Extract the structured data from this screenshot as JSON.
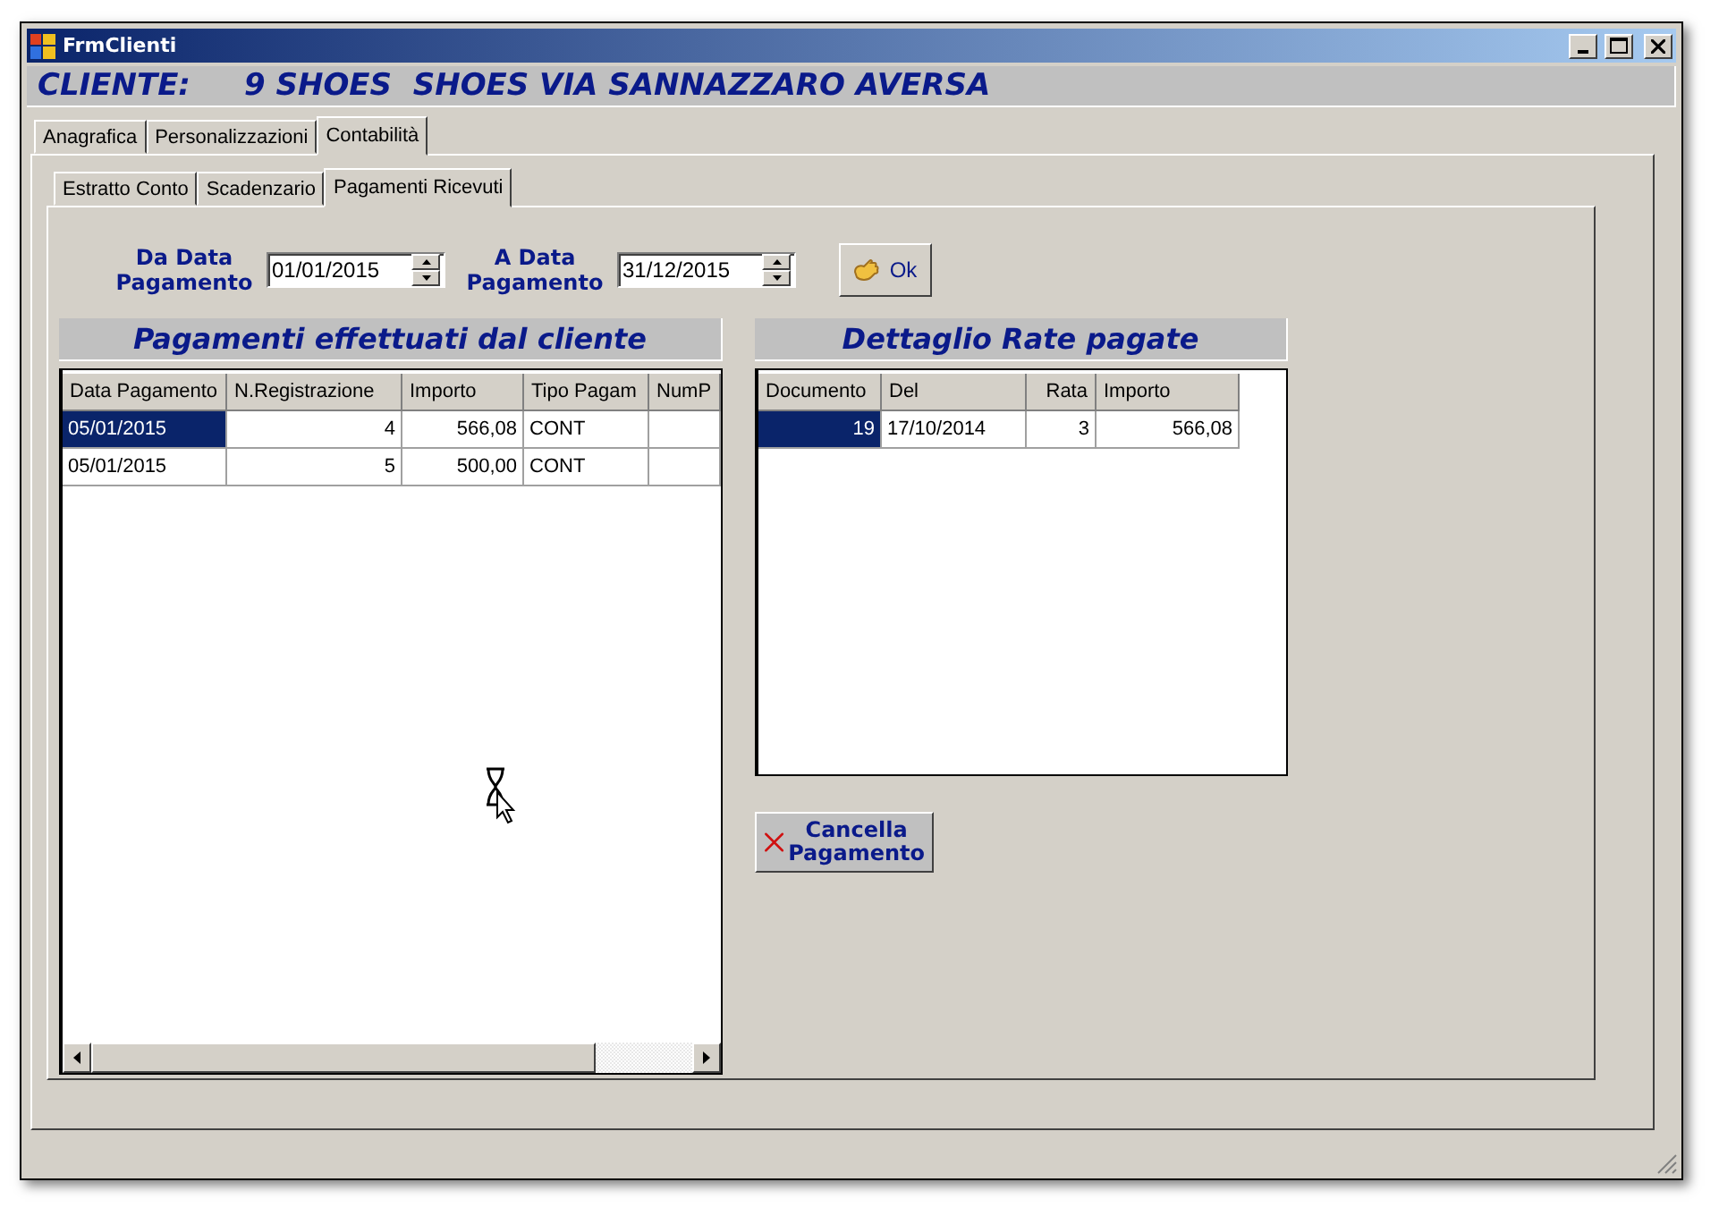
{
  "window": {
    "title": "FrmClienti"
  },
  "header": {
    "label": "CLIENTE:",
    "value": "9 SHOES  SHOES VIA SANNAZZARO AVERSA"
  },
  "tabs": [
    {
      "label": "Anagrafica",
      "selected": false
    },
    {
      "label": "Personalizzazioni",
      "selected": false
    },
    {
      "label": "Contabilità",
      "selected": true
    }
  ],
  "subtabs": [
    {
      "label": "Estratto Conto",
      "selected": false
    },
    {
      "label": "Scadenzario",
      "selected": false
    },
    {
      "label": "Pagamenti Ricevuti",
      "selected": true
    }
  ],
  "filters": [
    {
      "label": "Da Data Pagamento",
      "value": "01/01/2015"
    },
    {
      "label": "A Data Pagamento",
      "value": "31/12/2015"
    }
  ],
  "ok_button": "Ok",
  "payments": {
    "title": "Pagamenti effettuati dal cliente",
    "columns": [
      "Data Pagamento",
      "N.Registrazione",
      "Importo",
      "Tipo Pagam",
      "NumP"
    ],
    "rows": [
      {
        "cells": [
          "05/01/2015",
          "4",
          "566,08",
          "CONT",
          ""
        ],
        "selected": true
      },
      {
        "cells": [
          "05/01/2015",
          "5",
          "500,00",
          "CONT",
          ""
        ],
        "selected": false
      }
    ]
  },
  "installments": {
    "title": "Dettaglio Rate pagate",
    "columns": [
      "Documento",
      "Del",
      "Rata",
      "Importo"
    ],
    "rows": [
      {
        "cells": [
          "19",
          "17/10/2014",
          "3",
          "566,08"
        ],
        "selected": true
      }
    ]
  },
  "cancel_button": "Cancella Pagamento"
}
